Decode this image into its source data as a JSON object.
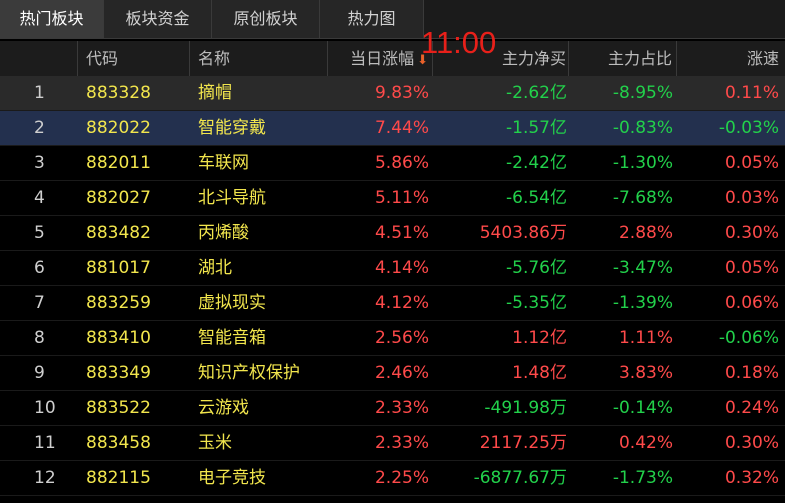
{
  "tabs": [
    {
      "label": "热门板块",
      "active": true
    },
    {
      "label": "板块资金",
      "active": false
    },
    {
      "label": "原创板块",
      "active": false
    },
    {
      "label": "热力图",
      "active": false
    }
  ],
  "clock": "11:00",
  "columns": {
    "index": "",
    "code": "代码",
    "name": "名称",
    "change": "当日涨幅",
    "net_buy": "主力净买",
    "ratio": "主力占比",
    "speed": "涨速"
  },
  "sort_icon": "arrow-down-icon",
  "colors": {
    "up": "#ff4a4a",
    "down": "#22d14b",
    "code_name": "#f2e64d",
    "clock": "#e8201a"
  },
  "rows": [
    {
      "idx": "1",
      "code": "883328",
      "name": "摘帽",
      "change": "9.83%",
      "net_buy": "-2.62亿",
      "ratio": "-8.95%",
      "speed": "0.11%"
    },
    {
      "idx": "2",
      "code": "882022",
      "name": "智能穿戴",
      "change": "7.44%",
      "net_buy": "-1.57亿",
      "ratio": "-0.83%",
      "speed": "-0.03%"
    },
    {
      "idx": "3",
      "code": "882011",
      "name": "车联网",
      "change": "5.86%",
      "net_buy": "-2.42亿",
      "ratio": "-1.30%",
      "speed": "0.05%"
    },
    {
      "idx": "4",
      "code": "882027",
      "name": "北斗导航",
      "change": "5.11%",
      "net_buy": "-6.54亿",
      "ratio": "-7.68%",
      "speed": "0.03%"
    },
    {
      "idx": "5",
      "code": "883482",
      "name": "丙烯酸",
      "change": "4.51%",
      "net_buy": "5403.86万",
      "ratio": "2.88%",
      "speed": "0.30%"
    },
    {
      "idx": "6",
      "code": "881017",
      "name": "湖北",
      "change": "4.14%",
      "net_buy": "-5.76亿",
      "ratio": "-3.47%",
      "speed": "0.05%"
    },
    {
      "idx": "7",
      "code": "883259",
      "name": "虚拟现实",
      "change": "4.12%",
      "net_buy": "-5.35亿",
      "ratio": "-1.39%",
      "speed": "0.06%"
    },
    {
      "idx": "8",
      "code": "883410",
      "name": "智能音箱",
      "change": "2.56%",
      "net_buy": "1.12亿",
      "ratio": "1.11%",
      "speed": "-0.06%"
    },
    {
      "idx": "9",
      "code": "883349",
      "name": "知识产权保护",
      "change": "2.46%",
      "net_buy": "1.48亿",
      "ratio": "3.83%",
      "speed": "0.18%"
    },
    {
      "idx": "10",
      "code": "883522",
      "name": "云游戏",
      "change": "2.33%",
      "net_buy": "-491.98万",
      "ratio": "-0.14%",
      "speed": "0.24%"
    },
    {
      "idx": "11",
      "code": "883458",
      "name": "玉米",
      "change": "2.33%",
      "net_buy": "2117.25万",
      "ratio": "0.42%",
      "speed": "0.30%"
    },
    {
      "idx": "12",
      "code": "882115",
      "name": "电子竞技",
      "change": "2.25%",
      "net_buy": "-6877.67万",
      "ratio": "-1.73%",
      "speed": "0.32%"
    }
  ]
}
